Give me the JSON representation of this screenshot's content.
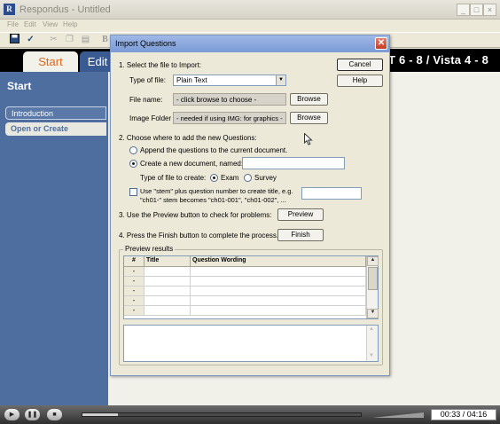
{
  "window": {
    "title": "Respondus - Untitled",
    "icon": "R",
    "controls": [
      "_",
      "□",
      "×"
    ]
  },
  "menu": [
    "File",
    "Edit",
    "View",
    "Help"
  ],
  "tabs": {
    "start": "Start",
    "edit": "Edit",
    "right_text": "T 6 - 8 / Vista 4 - 8"
  },
  "sidebar": {
    "title": "Start",
    "items": [
      {
        "label": "Introduction"
      },
      {
        "label": "Open or Create"
      }
    ]
  },
  "dialog": {
    "title": "Import Questions",
    "close": "✕",
    "step1": "1.  Select the file to Import:",
    "type_label": "Type of file:",
    "type_value": "Plain Text",
    "filename_label": "File name:",
    "filename_value": "- click browse to choose -",
    "imgfolder_label": "Image Folder",
    "imgfolder_value": "- needed if using IMG: for graphics -",
    "browse": "Browse",
    "cancel": "Cancel",
    "help": "Help",
    "step2": "2.  Choose where to add the new Questions:",
    "append": "Append the questions to the current document.",
    "create": "Create a new document, named:",
    "filetype_label": "Type of file to create:",
    "exam": "Exam",
    "survey": "Survey",
    "stem_line1": "Use \"stem\" plus question number to create title,  e.g.",
    "stem_line2": "\"ch01-\" stem becomes \"ch01-001\",  \"ch01-002\",  ...",
    "step3": "3.  Use the Preview button to check for problems:",
    "preview": "Preview",
    "step4": "4.  Press the Finish button to complete the process.",
    "finish": "Finish",
    "preview_results": "Preview results",
    "grid_headers": [
      "#",
      "Title",
      "Question Wording"
    ],
    "grid_rows": [
      "-",
      "-",
      "-",
      "-",
      "-"
    ]
  },
  "player": {
    "time": "00:33 / 04:16",
    "play": "▶",
    "pause": "❚❚",
    "stop": "■"
  }
}
